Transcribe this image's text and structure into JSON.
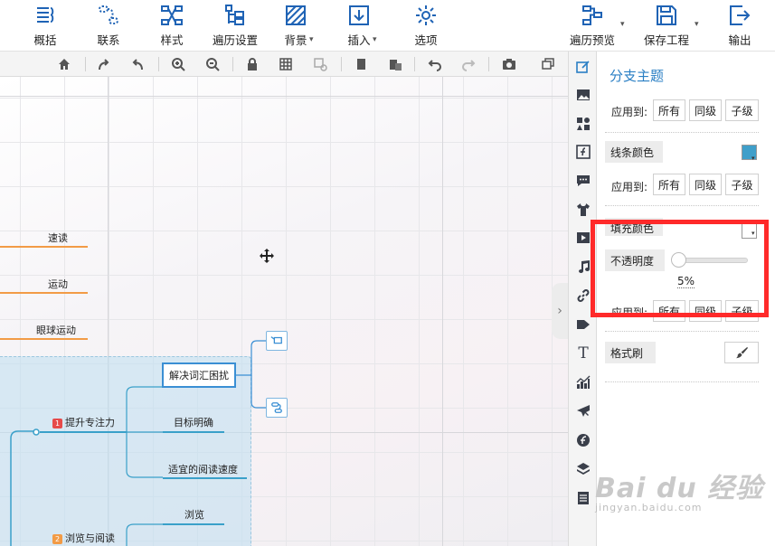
{
  "toolbar": {
    "outline": "概括",
    "relation": "联系",
    "style": "样式",
    "traverse": "遍历设置",
    "background": "背景",
    "insert": "插入",
    "options": "选项",
    "traverse_preview": "遍历预览",
    "save_project": "保存工程",
    "export": "输出"
  },
  "canvas": {
    "nodes": {
      "speed_read": "速读",
      "exercise": "运动",
      "eye_exercise": "眼球运动",
      "improve_focus": "提升专注力",
      "improve_focus_badge": "1",
      "resolve_vocab": "解决词汇困扰",
      "clear_goal": "目标明确",
      "proper_speed": "适宜的阅读速度",
      "browse": "浏览",
      "browse_read": "浏览与阅读",
      "browse_read_badge": "2"
    }
  },
  "panel": {
    "title": "分支主题",
    "apply_to": "应用到:",
    "all": "所有",
    "same_level": "同级",
    "child_level": "子级",
    "line_color": "线条颜色",
    "line_color_value": "#3f9fca",
    "fill_color": "填充颜色",
    "opacity": "不透明度",
    "opacity_value": "5%",
    "format_painter": "格式刷"
  },
  "watermark": {
    "brand": "Bai du 经验",
    "url": "jingyan.baidu.com"
  }
}
